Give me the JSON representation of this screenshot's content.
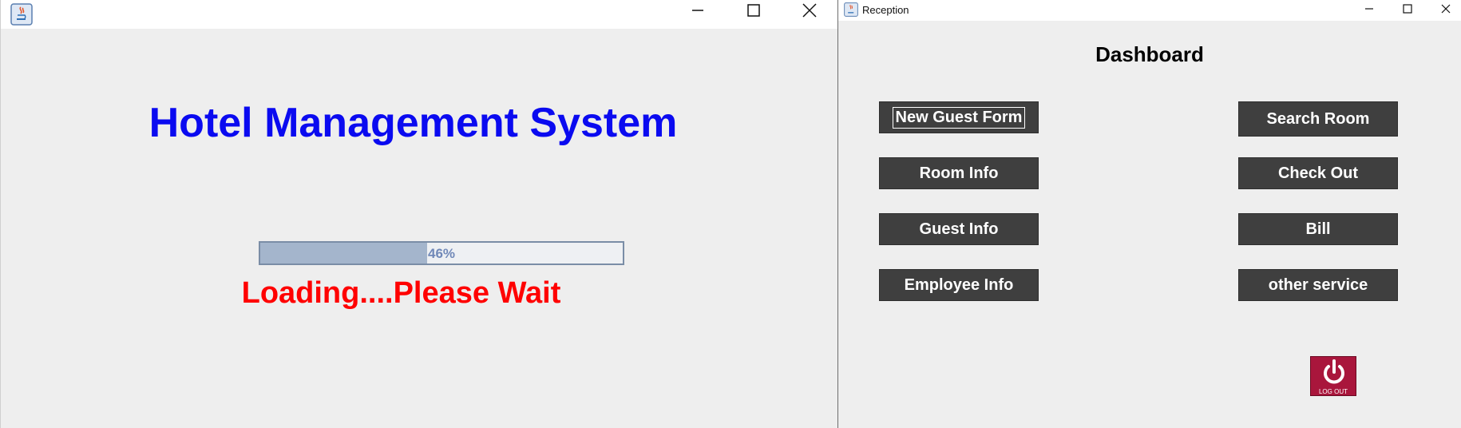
{
  "splash": {
    "title": "Hotel Management System",
    "progress": {
      "percent": 46,
      "label": "46%"
    },
    "loading_text": "Loading....Please Wait"
  },
  "reception": {
    "window_title": "Reception",
    "dashboard_title": "Dashboard",
    "buttons": [
      {
        "label": "New Guest Form"
      },
      {
        "label": "Search Room"
      },
      {
        "label": "Room Info"
      },
      {
        "label": "Check Out"
      },
      {
        "label": "Guest Info"
      },
      {
        "label": "Bill"
      },
      {
        "label": "Employee Info"
      },
      {
        "label": "other service"
      }
    ],
    "logout_label": "LOG OUT"
  },
  "colors": {
    "title_blue": "#0a0af0",
    "loading_red": "#ff0000",
    "button_bg": "#3f3f3f",
    "logout_bg": "#a9163c"
  },
  "icons": [
    "java-app-icon",
    "minimize-icon",
    "maximize-icon",
    "close-icon",
    "power-icon"
  ]
}
